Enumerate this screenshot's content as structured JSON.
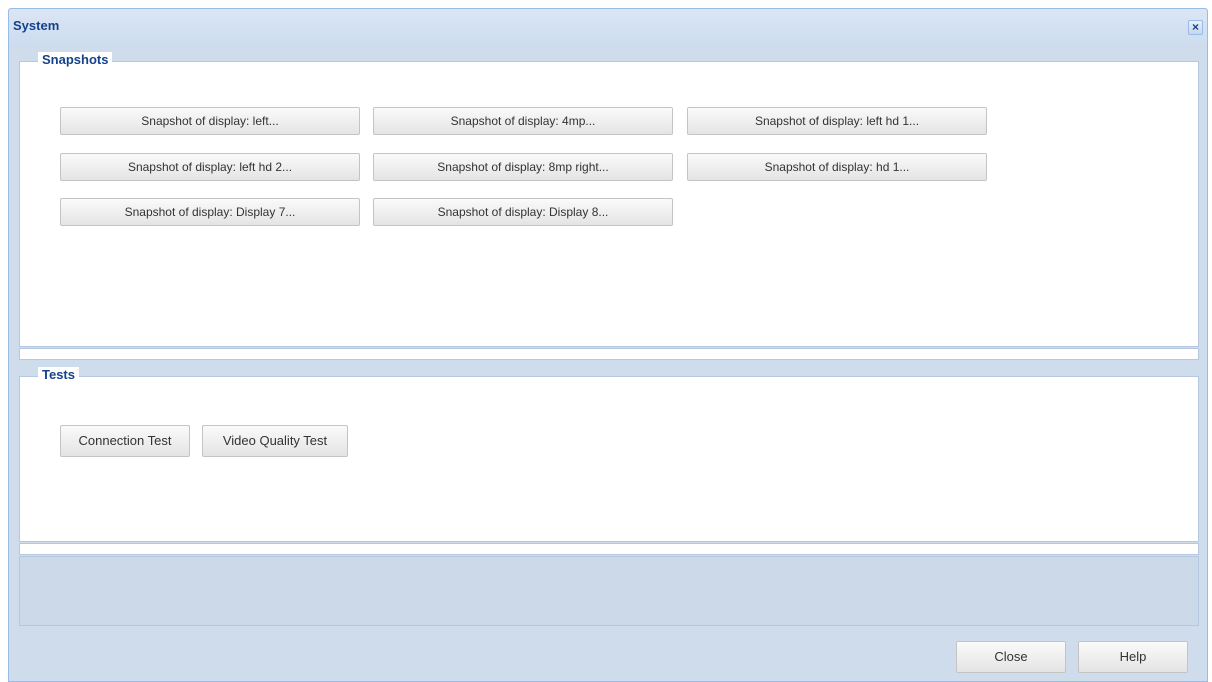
{
  "window": {
    "title": "System"
  },
  "snapshots": {
    "legend": "Snapshots",
    "buttons": [
      "Snapshot of display: left...",
      "Snapshot of display: 4mp...",
      "Snapshot of display: left hd 1...",
      "Snapshot of display: left hd 2...",
      "Snapshot of display: 8mp right...",
      "Snapshot of display: hd 1...",
      "Snapshot of display: Display 7...",
      "Snapshot of display: Display 8..."
    ]
  },
  "tests": {
    "legend": "Tests",
    "connection_label": "Connection Test",
    "video_quality_label": "Video Quality Test"
  },
  "footer": {
    "close_label": "Close",
    "help_label": "Help"
  },
  "icons": {
    "window_close": "close-icon"
  },
  "colors": {
    "title_text": "#15428b",
    "window_bg": "#cfdcec",
    "border": "#99bbe8"
  }
}
